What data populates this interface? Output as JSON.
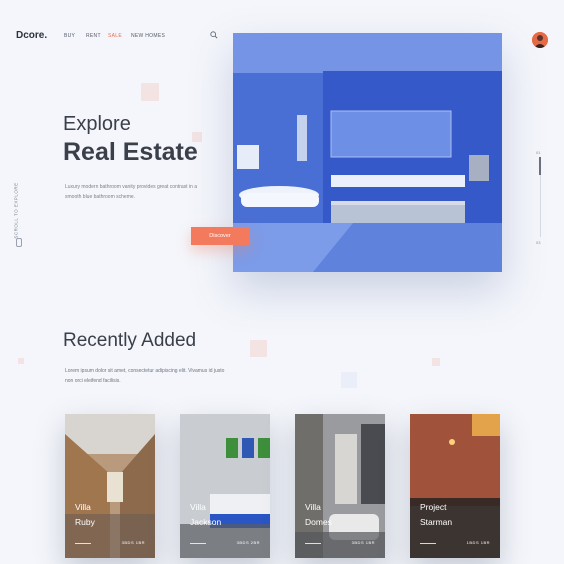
{
  "header": {
    "logo": "Dcore.",
    "nav": [
      {
        "label": "BUY"
      },
      {
        "label": "RENT"
      },
      {
        "label": "SALE"
      },
      {
        "label": "NEW HOMES"
      }
    ]
  },
  "hero": {
    "title_light": "Explore",
    "title_bold": "Real Estate",
    "description": "Luxury modern bathroom vanity provides great contrast in a smooth blue bathroom scheme.",
    "cta": "Discover",
    "scroll_label": "SCROLL TO EXPLORE",
    "pager_current": "01",
    "pager_total": "03"
  },
  "recent": {
    "title": "Recently Added",
    "description": "Lorem ipsum dolor sit amet, consectetur adipiscing elit. Vivamus id justo non orci eleifend facilisis.",
    "cards": [
      {
        "line1": "Villa",
        "line2": "Ruby",
        "meta": "3BDS 1BR"
      },
      {
        "line1": "Villa",
        "line2": "Jackson",
        "meta": "3BDS 2BR"
      },
      {
        "line1": "Villa",
        "line2": "Domes",
        "meta": "3BDS 1BR"
      },
      {
        "line1": "Project",
        "line2": "Starman",
        "meta": "1BDS 1BR"
      }
    ]
  },
  "colors": {
    "accent": "#f47a5e",
    "background": "#f4f6fb",
    "text": "#3a3f4a"
  }
}
